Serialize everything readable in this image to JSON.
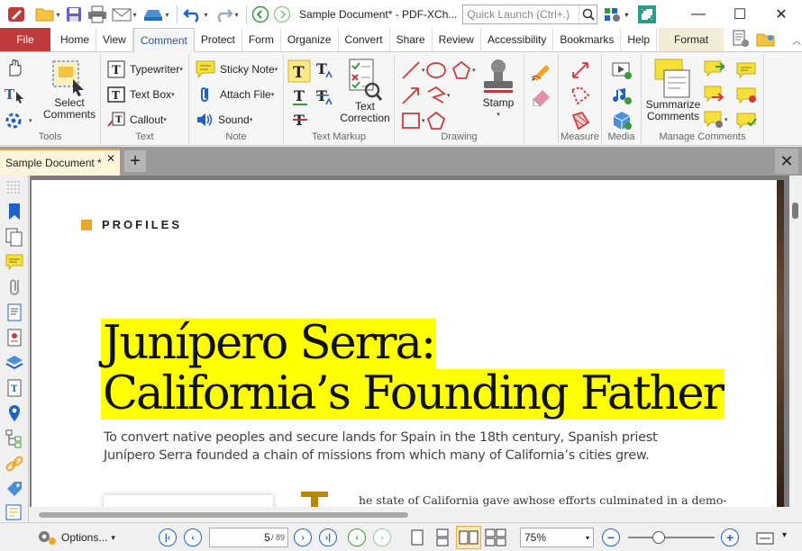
{
  "window": {
    "title": "Sample Document* - PDF-XCh...",
    "quick_launch_placeholder": "Quick Launch (Ctrl+.)"
  },
  "ribbon_tabs": [
    "File",
    "Home",
    "View",
    "Comment",
    "Protect",
    "Form",
    "Organize",
    "Convert",
    "Share",
    "Review",
    "Accessibility",
    "Bookmarks",
    "Help",
    "Format"
  ],
  "active_tab": "Comment",
  "ribbon": {
    "tools": {
      "label": "Tools",
      "select_comments": "Select Comments"
    },
    "text": {
      "label": "Text",
      "typewriter": "Typewriter",
      "text_box": "Text Box",
      "callout": "Callout"
    },
    "note": {
      "label": "Note",
      "sticky_note": "Sticky Note",
      "attach_file": "Attach File",
      "sound": "Sound"
    },
    "text_markup": {
      "label": "Text Markup",
      "text_correction": "Text Correction"
    },
    "drawing": {
      "label": "Drawing",
      "stamp": "Stamp"
    },
    "measure": {
      "label": "Measure"
    },
    "media": {
      "label": "Media"
    },
    "manage": {
      "label": "Manage Comments",
      "summarize": "Summarize Comments"
    }
  },
  "doc_tab": {
    "title": "Sample Document *"
  },
  "document": {
    "section_label": "PROFILES",
    "headline_line1": "Junípero Serra:",
    "headline_line2": "California’s Founding Father",
    "subtitle": "To convert native peoples and secure lands for Spain in the 18th century, Spanish priest Junípero Serra founded a chain of missions from which many of California’s cities grew.",
    "body_col1": "he state of California gave a",
    "body_col2": "whose efforts culminated in a demo-"
  },
  "statusbar": {
    "options_label": "Options...",
    "current_page": "5",
    "total_pages": "/ 89",
    "zoom": "75%",
    "zoom_level": 0.35
  },
  "colors": {
    "file_tab": "#c0393b",
    "highlight": "#ffff00",
    "accent_orange": "#e9a52c",
    "nav_blue": "#1e62c8"
  }
}
